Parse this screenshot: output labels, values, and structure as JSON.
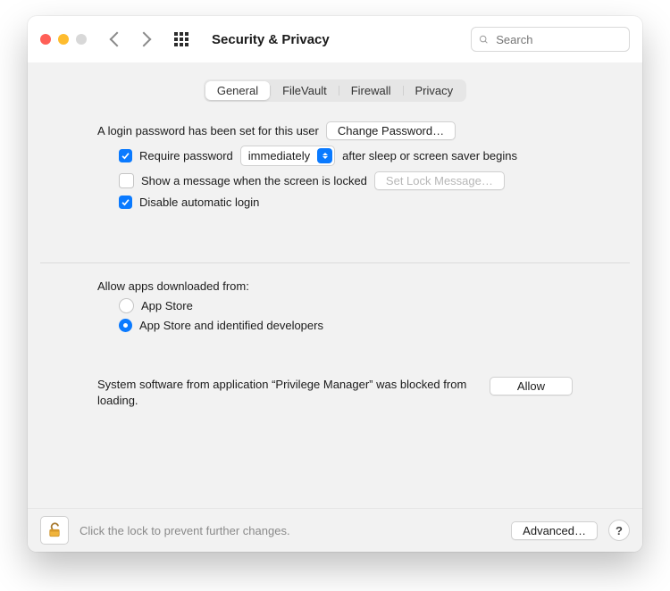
{
  "window": {
    "title": "Security & Privacy"
  },
  "search": {
    "placeholder": "Search"
  },
  "tabs": {
    "general": "General",
    "filevault": "FileVault",
    "firewall": "Firewall",
    "privacy": "Privacy",
    "active": "general"
  },
  "login": {
    "password_set_label": "A login password has been set for this user",
    "change_password_button": "Change Password…",
    "require_password": {
      "checked": true,
      "label_before": "Require password",
      "delay_value": "immediately",
      "label_after": "after sleep or screen saver begins"
    },
    "show_message": {
      "checked": false,
      "label": "Show a message when the screen is locked",
      "set_message_button": "Set Lock Message…"
    },
    "disable_auto_login": {
      "checked": true,
      "label": "Disable automatic login"
    }
  },
  "downloads": {
    "heading": "Allow apps downloaded from:",
    "options": {
      "app_store": "App Store",
      "identified": "App Store and identified developers"
    },
    "selected": "identified"
  },
  "blocked": {
    "message": "System software from application “Privilege Manager” was blocked from loading.",
    "allow_button": "Allow"
  },
  "footer": {
    "hint": "Click the lock to prevent further changes.",
    "advanced_button": "Advanced…"
  }
}
